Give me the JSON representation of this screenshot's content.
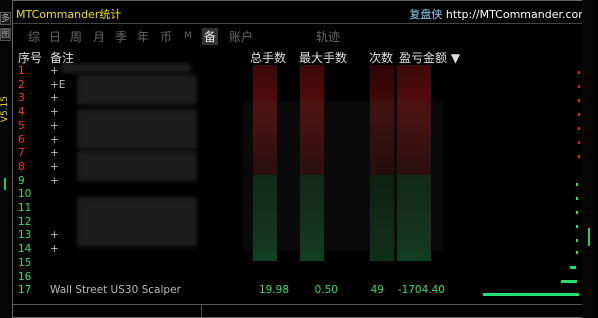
{
  "app": {
    "title": "MTCommander统计",
    "brand_cn": "复盘侠",
    "brand_url": "http://MTCommander.com"
  },
  "left_strip": {
    "buttons": [
      "多",
      "图"
    ],
    "version": "V5.15"
  },
  "tabs": [
    {
      "label": "综",
      "active": false
    },
    {
      "label": "日",
      "active": false
    },
    {
      "label": "周",
      "active": false
    },
    {
      "label": "月",
      "active": false
    },
    {
      "label": "季",
      "active": false
    },
    {
      "label": "年",
      "active": false
    },
    {
      "label": "币",
      "active": false
    },
    {
      "label": "M",
      "active": false
    },
    {
      "label": "备",
      "active": true
    },
    {
      "label": "账户",
      "active": false
    },
    {
      "label": "轨迹",
      "active": false
    }
  ],
  "table": {
    "headers": {
      "idx": "序号",
      "note": "备注",
      "total_lots": "总手数",
      "max_lots": "最大手数",
      "count": "次数",
      "pnl": "盈亏金额 ▼"
    },
    "rows": [
      {
        "idx": "1",
        "note": "+",
        "color": "#ff3030"
      },
      {
        "idx": "2",
        "note": "+E",
        "color": "#ff3030"
      },
      {
        "idx": "3",
        "note": "+",
        "color": "#ff3030"
      },
      {
        "idx": "4",
        "note": "+",
        "color": "#ff3030"
      },
      {
        "idx": "5",
        "note": "+",
        "color": "#ff3030"
      },
      {
        "idx": "6",
        "note": "+",
        "color": "#ff3030"
      },
      {
        "idx": "7",
        "note": "+",
        "color": "#ff3030"
      },
      {
        "idx": "8",
        "note": "+",
        "color": "#ff3030"
      },
      {
        "idx": "9",
        "note": "+",
        "color": "#30e060"
      },
      {
        "idx": "10",
        "note": "",
        "color": "#30e060"
      },
      {
        "idx": "11",
        "note": "",
        "color": "#30e060"
      },
      {
        "idx": "12",
        "note": "",
        "color": "#30e060"
      },
      {
        "idx": "13",
        "note": "+",
        "color": "#30e060"
      },
      {
        "idx": "14",
        "note": "+",
        "color": "#30e060"
      },
      {
        "idx": "15",
        "note": "",
        "color": "#30e060"
      },
      {
        "idx": "16",
        "note": "",
        "color": "#30e060"
      },
      {
        "idx": "17",
        "note": "Wall Street US30 Scalper",
        "total_lots": "19.98",
        "max_lots": "0.50",
        "count": "49",
        "pnl": "-1704.40",
        "color": "#30e060"
      }
    ]
  }
}
